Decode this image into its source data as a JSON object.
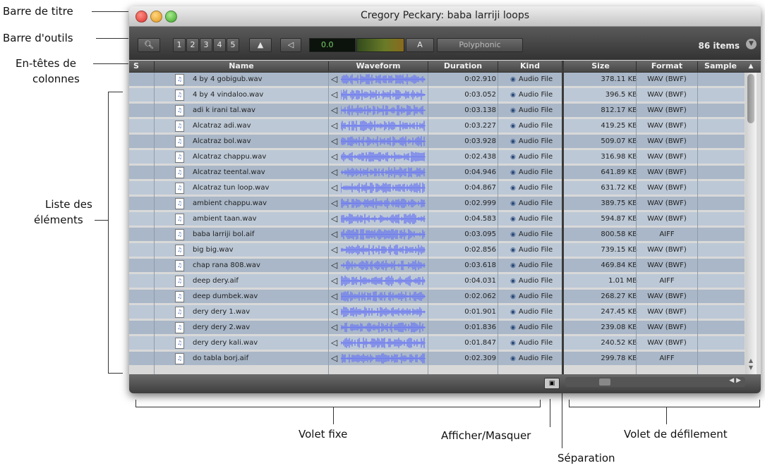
{
  "window": {
    "title": "Cregory Peckary: baba larriji loops",
    "items_count": "86 items",
    "toolbar": {
      "view_numbers": [
        "1",
        "2",
        "3",
        "4",
        "5"
      ],
      "level_value": "0.0",
      "ab_label": "A",
      "mode_label": "Polyphonic"
    },
    "columns": [
      "S",
      "Name",
      "Waveform",
      "Duration",
      "Kind",
      "Size",
      "Format",
      "Sample"
    ],
    "kind_value": "Audio File",
    "rows": [
      {
        "name": "4 by 4 gobigub.wav",
        "duration": "0:02.910",
        "size": "378.11 KB",
        "format": "WAV (BWF)"
      },
      {
        "name": "4 by 4 vindaloo.wav",
        "duration": "0:03.052",
        "size": "396.5 KB",
        "format": "WAV (BWF)"
      },
      {
        "name": "adi k irani tal.wav",
        "duration": "0:03.138",
        "size": "812.17 KB",
        "format": "WAV (BWF)"
      },
      {
        "name": "Alcatraz adi.wav",
        "duration": "0:03.227",
        "size": "419.25 KB",
        "format": "WAV (BWF)"
      },
      {
        "name": "Alcatraz bol.wav",
        "duration": "0:03.928",
        "size": "509.07 KB",
        "format": "WAV (BWF)"
      },
      {
        "name": "Alcatraz chappu.wav",
        "duration": "0:02.438",
        "size": "316.98 KB",
        "format": "WAV (BWF)"
      },
      {
        "name": "Alcatraz teental.wav",
        "duration": "0:04.946",
        "size": "641.89 KB",
        "format": "WAV (BWF)"
      },
      {
        "name": "Alcatraz tun loop.wav",
        "duration": "0:04.867",
        "size": "631.72 KB",
        "format": "WAV (BWF)"
      },
      {
        "name": "ambient chappu.wav",
        "duration": "0:02.999",
        "size": "389.75 KB",
        "format": "WAV (BWF)"
      },
      {
        "name": "ambient taan.wav",
        "duration": "0:04.583",
        "size": "594.87 KB",
        "format": "WAV (BWF)"
      },
      {
        "name": "baba larriji bol.aif",
        "duration": "0:03.095",
        "size": "800.58 KB",
        "format": "AIFF"
      },
      {
        "name": "big big.wav",
        "duration": "0:02.856",
        "size": "739.15 KB",
        "format": "WAV (BWF)"
      },
      {
        "name": "chap rana 808.wav",
        "duration": "0:03.618",
        "size": "469.84 KB",
        "format": "WAV (BWF)"
      },
      {
        "name": "deep dery.aif",
        "duration": "0:04.031",
        "size": "1.01 MB",
        "format": "AIFF"
      },
      {
        "name": "deep dumbek.wav",
        "duration": "0:02.062",
        "size": "268.27 KB",
        "format": "WAV (BWF)"
      },
      {
        "name": "dery dery 1.wav",
        "duration": "0:01.901",
        "size": "247.45 KB",
        "format": "WAV (BWF)"
      },
      {
        "name": "dery dery 2.wav",
        "duration": "0:01.836",
        "size": "239.08 KB",
        "format": "WAV (BWF)"
      },
      {
        "name": "dery dery kali.wav",
        "duration": "0:01.847",
        "size": "240.52 KB",
        "format": "WAV (BWF)"
      },
      {
        "name": "do tabla borj.aif",
        "duration": "0:02.309",
        "size": "299.78 KB",
        "format": "AIFF"
      }
    ]
  },
  "annotations": {
    "titlebar": "Barre de titre",
    "toolbar": "Barre d'outils",
    "headers_line1": "En-têtes de",
    "headers_line2": "colonnes",
    "list_line1": "Liste des",
    "list_line2": "éléments",
    "fixed_pane": "Volet fixe",
    "show_hide": "Afficher/Masquer",
    "separation": "Séparation",
    "scroll_pane": "Volet de défilement"
  },
  "colors": {
    "row_odd": "#a9b7c8",
    "row_even": "#bcc8d6",
    "waveform": "#6f7cf0"
  }
}
